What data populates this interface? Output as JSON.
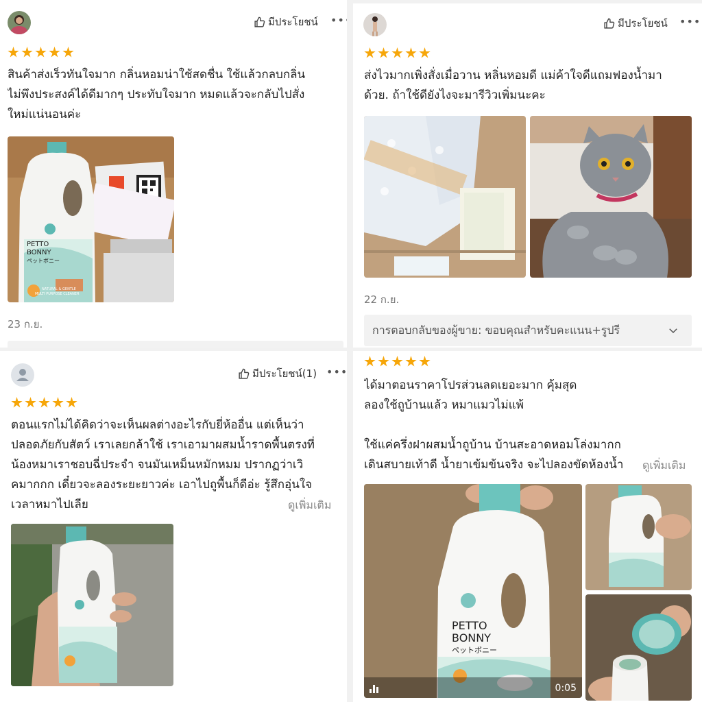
{
  "colors": {
    "star": "#f6a609",
    "teal": "#5cb8b2",
    "text": "#222222",
    "muted": "#888888"
  },
  "reviews": [
    {
      "helpful_label": "มีประโยชน์",
      "more_glyph": "•••",
      "rating": 5,
      "lines": [
        "สินค้าส่งเร็วทันใจมาก กลิ่นหอมน่าใช้สดชื่น ใช้แล้วกลบกลิ่น",
        "ไม่พึงประสงค์ได้ดีมากๆ ประทับใจมาก หมดแล้วจะกลับไปสั่ง",
        "ใหม่แน่นอนค่ะ"
      ],
      "date": "23 ก.ย."
    },
    {
      "helpful_label": "มีประโยชน์",
      "more_glyph": "•••",
      "rating": 5,
      "lines": [
        "ส่งไวมากเพิ่งสั่งเมื่อวาน หลิ่นหอมดี แม่ค้าใจดีแถมฟองน้ำมา",
        "ด้วย. ถ้าใช้ดียังไงจะมารีวิวเพิ่มนะคะ"
      ],
      "date": "22 ก.ย.",
      "seller_reply": "การตอบกลับของผู้ขาย: ขอบคุณสำหรับคะแนน+รูปรี"
    },
    {
      "helpful_label": "มีประโยชน์(1)",
      "more_glyph": "•••",
      "rating": 5,
      "lines": [
        "ตอนแรกไม่ได้คิดว่าจะเห็นผลต่างอะไรกับยี่ห้ออื่น แต่เห็นว่า",
        "ปลอดภัยกับสัตว์ เราเลยกล้าใช้ เราเอามาผสมน้ำราดพื้นตรงที่",
        "น้องหมาเราชอบฉี่ประจำ จนมันเหม็นหมักหมม ปรากฏว่าเวิ",
        "คมากกก เดี๋ยวจะลองระยะยาวค่ะ เอาไปถูพื้นก็ดีอ่ะ รู้สึกอุ่นใจ",
        "เวลาหมาไปเลีย"
      ],
      "see_more": "ดูเพิ่มเติม"
    },
    {
      "rating": 5,
      "lines": [
        "ได้มาตอนราคาโปรส่วนลดเยอะมาก คุ้มสุด",
        "ลองใช้ถูบ้านแล้ว หมาแมวไม่แพ้",
        "",
        "ใช้แค่ครึ่งฝาผสมน้ำถูบ้าน บ้านสะอาดหอมโล่งมากก",
        "เดินสบายเท้าดี น้ำยาเข้มข้นจริง จะไปลองขัดห้องน้ำ"
      ],
      "see_more": "ดูเพิ่มเติม",
      "video_duration": "0:05"
    }
  ],
  "product_label": {
    "brand_line1": "PETTO",
    "brand_line2": "BONNY",
    "brand_jp": "ペットボニー",
    "product_line1": "NATURAL & GENTLE",
    "product_line2": "MULTI PURPOSE CLEANER"
  }
}
